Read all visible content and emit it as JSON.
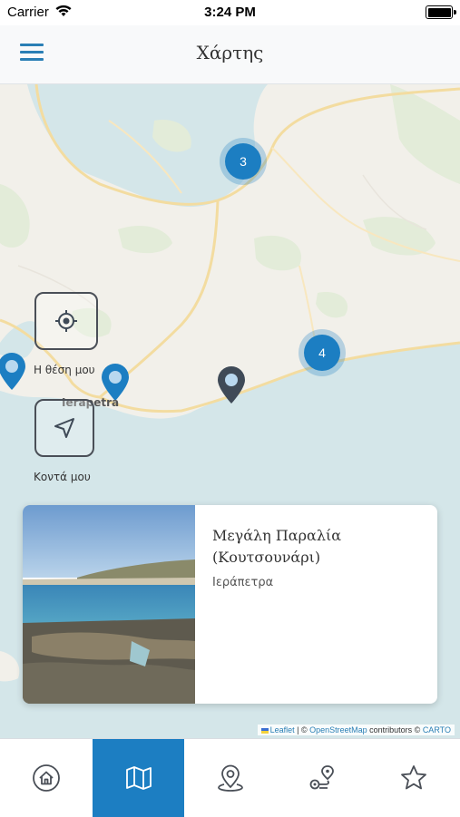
{
  "status_bar": {
    "carrier": "Carrier",
    "time": "3:24 PM",
    "battery_level": 1.0
  },
  "header": {
    "title": "Χάρτης",
    "menu_icon": "hamburger-menu-icon",
    "accent": "#2a7fb5"
  },
  "map": {
    "clusters": [
      {
        "count": "3"
      },
      {
        "count": "4"
      }
    ],
    "place_label": "Ierapetra",
    "controls": {
      "my_location_label": "Η θέση μου",
      "nearby_label": "Κοντά μου"
    },
    "attribution": {
      "leaflet": "Leaflet",
      "sep1": " | © ",
      "osm": "OpenStreetMap",
      "contrib": " contributors © ",
      "carto": "CARTO"
    }
  },
  "card": {
    "title_line1": "Μεγάλη Παραλία",
    "title_line2": "(Κουτσουνάρι)",
    "location": "Ιεράπετρα"
  },
  "tabbar": {
    "active_index": 1,
    "tabs": [
      {
        "icon": "home-icon"
      },
      {
        "icon": "map-icon"
      },
      {
        "icon": "location-pin-icon"
      },
      {
        "icon": "route-icon"
      },
      {
        "icon": "star-icon"
      }
    ]
  },
  "colors": {
    "primary": "#1c7ec2",
    "sea": "#d4e6e9",
    "land": "#f2f0ea",
    "road": "#f3dca0"
  }
}
